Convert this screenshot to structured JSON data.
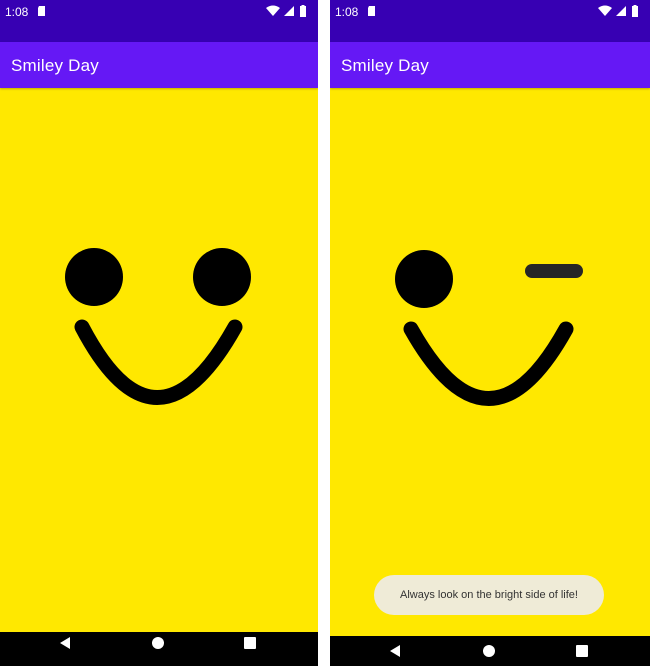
{
  "screens": [
    {
      "status_time": "1:08",
      "app_title": "Smiley Day",
      "expression": "smile"
    },
    {
      "status_time": "1:08",
      "app_title": "Smiley Day",
      "expression": "wink",
      "toast": "Always look on the bright side of life!"
    }
  ],
  "colors": {
    "status_bar": "#3700b3",
    "app_bar": "#6518f5",
    "face_background": "#ffe800",
    "face_features": "#000000",
    "toast_background": "#efebd7"
  }
}
